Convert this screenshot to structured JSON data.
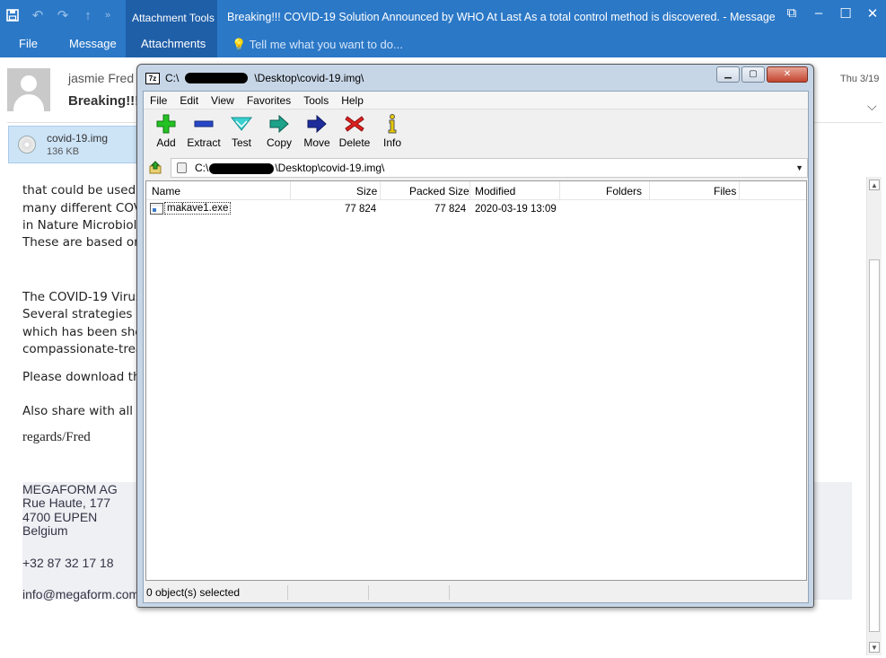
{
  "outlook": {
    "context_group": "Attachment Tools",
    "window_title": "Breaking!!! COVID-19 Solution Announced by WHO At Last As a total control method is discovered. - Message (H...",
    "tabs": [
      "File",
      "Message",
      "Attachments"
    ],
    "tell_me": "Tell me what you want to do...",
    "colors": {
      "ribbon": "#2b78c7",
      "context": "#1f5fa8"
    }
  },
  "message": {
    "sender": "jasmie Fred",
    "subject": "Breaking!!!",
    "date": "Thu 3/19",
    "attachment": {
      "name": "covid-19.img",
      "size": "136 KB"
    }
  },
  "body": {
    "lines1": [
      "that could be used t",
      "many different COV",
      "in Nature Microbiol",
      "These are based on"
    ],
    "lines2": [
      "The COVID-19 Virus",
      "Several strategies h",
      "which has been sho",
      "compassionate-trea"
    ],
    "download": "Please download th",
    "share": "Also share with all c",
    "regards": "regards/Fred"
  },
  "signature": {
    "company": "MEGAFORM AG",
    "street": "Rue Haute, 177",
    "city": "4700 EUPEN",
    "country": "Belgium",
    "phone": "+32 87 32 17 18",
    "email": "info@megaform.com"
  },
  "sevenzip": {
    "title_prefix": "C:\\",
    "title_suffix": "\\Desktop\\covid-19.img\\",
    "logo": "7z",
    "menu": [
      "File",
      "Edit",
      "View",
      "Favorites",
      "Tools",
      "Help"
    ],
    "toolbar": [
      "Add",
      "Extract",
      "Test",
      "Copy",
      "Move",
      "Delete",
      "Info"
    ],
    "path_prefix": "C:\\",
    "path_suffix": "\\Desktop\\covid-19.img\\",
    "columns": [
      "Name",
      "Size",
      "Packed Size",
      "Modified",
      "Folders",
      "Files"
    ],
    "rows": [
      {
        "name": "makave1.exe",
        "size": "77 824",
        "packed": "77 824",
        "modified": "2020-03-19 13:09"
      }
    ],
    "status": "0 object(s) selected"
  }
}
